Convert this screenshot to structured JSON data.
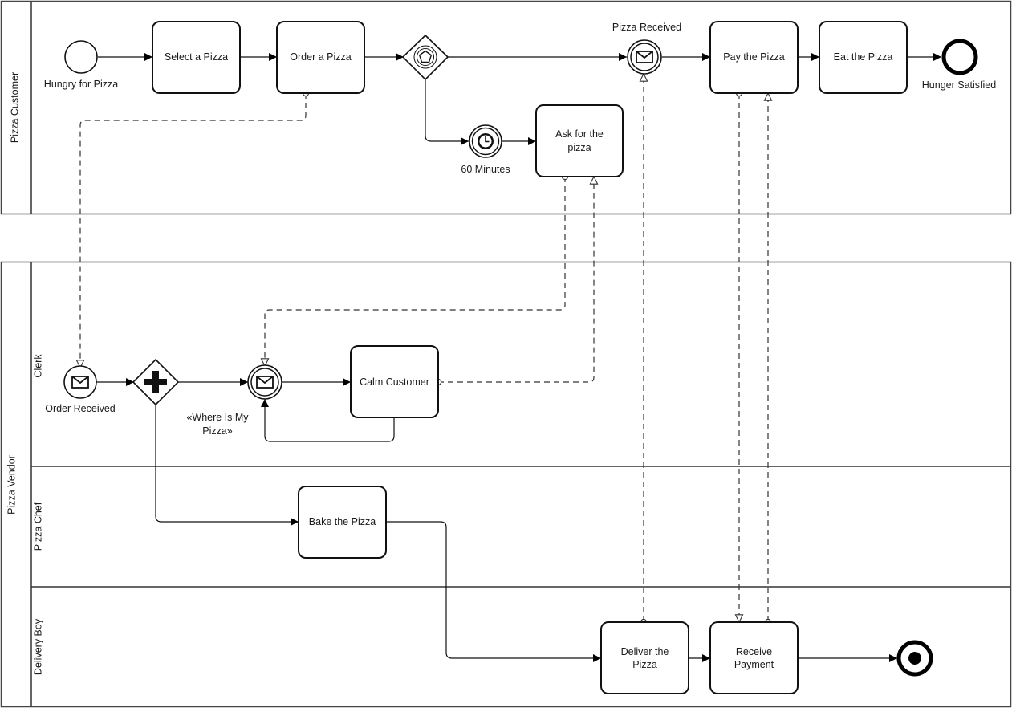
{
  "diagram": {
    "type": "BPMN collaboration",
    "pools": [
      {
        "id": "pizza-customer",
        "label": "Pizza Customer",
        "lanes": []
      },
      {
        "id": "pizza-vendor",
        "label": "Pizza Vendor",
        "lanes": [
          {
            "id": "clerk",
            "label": "Clerk"
          },
          {
            "id": "pizza-chef",
            "label": "Pizza Chef"
          },
          {
            "id": "delivery-boy",
            "label": "Delivery Boy"
          }
        ]
      }
    ],
    "tasks": {
      "select_pizza": [
        "Select a Pizza"
      ],
      "order_pizza": [
        "Order a Pizza"
      ],
      "ask_pizza": [
        "Ask for the",
        "pizza"
      ],
      "pay_pizza": [
        "Pay the Pizza"
      ],
      "eat_pizza": [
        "Eat the Pizza"
      ],
      "calm_customer": [
        "Calm Customer"
      ],
      "bake_pizza": [
        "Bake the Pizza"
      ],
      "deliver_pizza": [
        "Deliver the",
        "Pizza"
      ],
      "receive_payment": [
        "Receive",
        "Payment"
      ]
    },
    "events": {
      "hungry": {
        "label": "Hungry for Pizza",
        "kind": "start"
      },
      "timer": {
        "label": "60 Minutes",
        "kind": "intermediate-timer"
      },
      "pizza_received": {
        "label": "Pizza Received",
        "kind": "intermediate-message-catch"
      },
      "hunger_satisfied": {
        "label": "Hunger Satisfied",
        "kind": "end"
      },
      "order_received": {
        "label": "Order Received",
        "kind": "start-message"
      },
      "where_is_pizza": {
        "label": [
          "«Where Is My",
          "Pizza»"
        ],
        "kind": "intermediate-message-catch"
      },
      "vendor_end": {
        "label": "",
        "kind": "end-terminate"
      }
    },
    "gateways": {
      "event_based": {
        "kind": "event-based"
      },
      "parallel": {
        "kind": "parallel"
      }
    },
    "colors": {
      "stroke": "#111111",
      "background": "#ffffff",
      "text": "#1a1a1a"
    }
  }
}
